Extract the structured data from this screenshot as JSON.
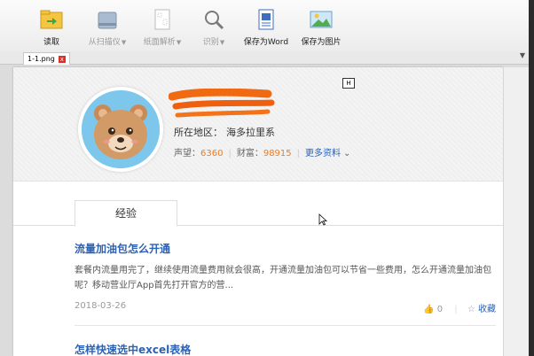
{
  "toolbar": {
    "items": [
      {
        "label": "读取",
        "icon": "folder-open-icon"
      },
      {
        "label": "从扫描仪",
        "icon": "scanner-icon"
      },
      {
        "label": "纸面解析",
        "icon": "page-layout-icon"
      },
      {
        "label": "识别",
        "icon": "magnifier-icon"
      },
      {
        "label": "保存为Word",
        "icon": "word-document-icon"
      },
      {
        "label": "保存为图片",
        "icon": "image-icon"
      }
    ]
  },
  "tabs": {
    "active": "1-1.png",
    "close_glyph": "x"
  },
  "profile": {
    "badge": "H",
    "region_label": "所在地区：",
    "region_value": "海多拉里系",
    "reputation_label": "声望：",
    "reputation_value": "6360",
    "wealth_label": "财富：",
    "wealth_value": "98915",
    "more_label": "更多资料"
  },
  "content_tab": "经验",
  "articles": [
    {
      "title": "流量加油包怎么开通",
      "desc": "套餐内流量用完了，继续使用流量费用就会很高，开通流量加油包可以节省一些费用，怎么开通流量加油包呢？移动营业厅App首先打开官方的营...",
      "date": "2018-03-26",
      "likes": "0",
      "fav_label": "收藏"
    },
    {
      "title": "怎样快速选中excel表格"
    }
  ],
  "colors": {
    "accent_link": "#2d62b3",
    "number_orange": "#f07a1e",
    "close_red": "#d9302a"
  }
}
